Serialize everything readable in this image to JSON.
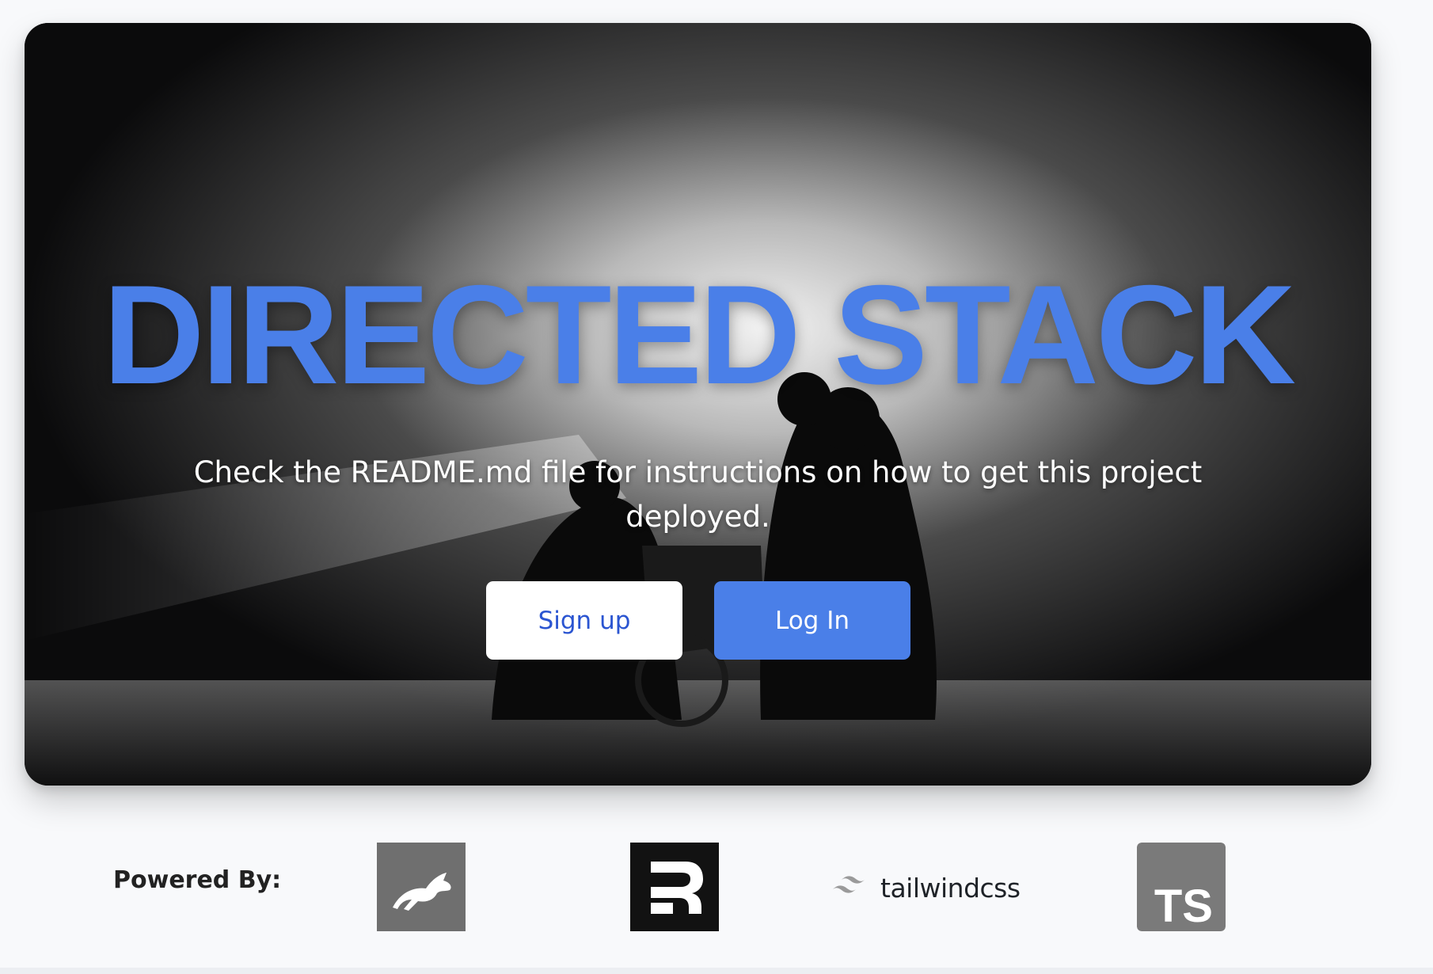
{
  "hero": {
    "title": "DIRECTED STACK",
    "subtitle": "Check the README.md file for instructions on how to get this project deployed.",
    "signup_label": "Sign up",
    "login_label": "Log In"
  },
  "colors": {
    "accent": "#4a7fe8",
    "signup_text": "#2b55d1",
    "ts_bg": "#7a7a7a",
    "remix_bg": "#121212",
    "fly_bg": "#6f6f6f"
  },
  "footer": {
    "powered_label": "Powered By:",
    "logos": [
      {
        "name": "fly",
        "icon": "rabbit-icon"
      },
      {
        "name": "remix",
        "icon": "remix-r-icon"
      },
      {
        "name": "tailwindcss",
        "text": "tailwindcss",
        "icon": "tailwind-wave-icon"
      },
      {
        "name": "typescript",
        "text": "TS",
        "icon": "ts-icon"
      }
    ]
  }
}
